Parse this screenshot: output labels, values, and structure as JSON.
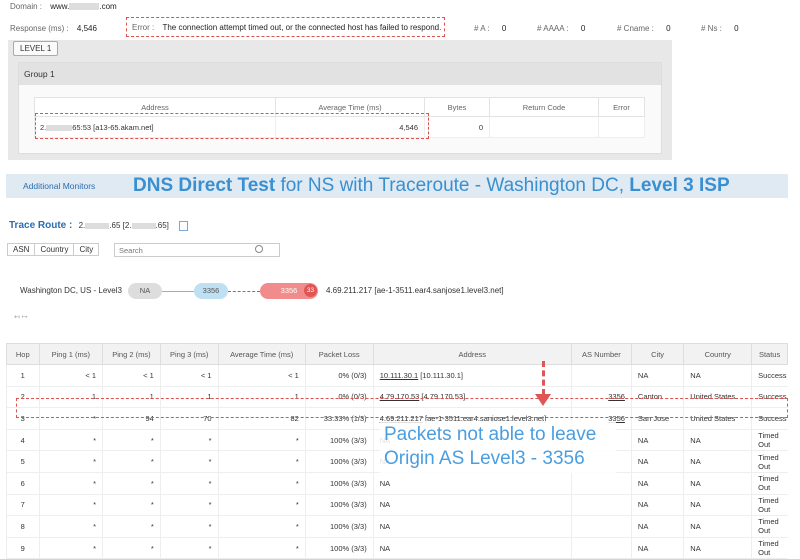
{
  "top": {
    "domain_label": "Domain :",
    "domain_value": "www.",
    "domain_suffix": ".com",
    "response_label": "Response (ms) :",
    "response_value": "4,546",
    "error_label": "Error :",
    "error_text": "The connection attempt timed out, or the connected host has failed to respond.",
    "a_label": "# A :",
    "a_value": "0",
    "aaaa_label": "# AAAA :",
    "aaaa_value": "0",
    "cname_label": "# Cname :",
    "cname_value": "0",
    "ns_label": "# Ns :",
    "ns_value": "0"
  },
  "level_button": "LEVEL 1",
  "group": {
    "title": "Group 1",
    "columns": [
      "Address",
      "Average Time (ms)",
      "Bytes",
      "Return Code",
      "Error"
    ],
    "row": {
      "address_prefix": "2.",
      "address_suffix": "65:53 [a13-65.akam.net]",
      "avg": "4,546",
      "bytes": "0",
      "return_code": "",
      "error": ""
    }
  },
  "banner": {
    "link": "Additional Monitors",
    "title_bold1": "DNS Direct Test",
    "title_mid": " for NS with Traceroute - Washington DC, ",
    "title_bold2": "Level 3 ISP"
  },
  "traceroute": {
    "label": "Trace Route :",
    "value_prefix": "2.",
    "value_mid": ".65 [2.",
    "value_suffix": ".65]",
    "tabs": [
      "ASN",
      "Country",
      "City"
    ],
    "search_placeholder": "Search",
    "origin": "Washington DC, US - Level3",
    "node1": "NA",
    "node2": "3356",
    "node3": "3356",
    "node3_badge": "33",
    "dest": "4.69.211.217 [ae-1-3511.ear4.sanjose1.level3.net]",
    "collapse": "↤ ↦"
  },
  "hops": {
    "columns": [
      "Hop",
      "Ping 1 (ms)",
      "Ping 2 (ms)",
      "Ping 3 (ms)",
      "Average Time (ms)",
      "Packet Loss",
      "Address",
      "AS Number",
      "City",
      "Country",
      "Status"
    ],
    "rows": [
      {
        "hop": "1",
        "p1": "< 1",
        "p2": "< 1",
        "p3": "< 1",
        "avg": "< 1",
        "loss": "0% (0/3)",
        "addr_link": "10.111.30.1",
        "addr_rest": " [10.111.30.1]",
        "asn": "",
        "city": "NA",
        "country": "NA",
        "status": "Success"
      },
      {
        "hop": "2",
        "p1": "1",
        "p2": "1",
        "p3": "1",
        "avg": "1",
        "loss": "0% (0/3)",
        "addr_link": "4.79.170.53",
        "addr_rest": " [4.79.170.53]",
        "asn": "3356",
        "city": "Canton",
        "country": "United States",
        "status": "Success"
      },
      {
        "hop": "3",
        "p1": "*",
        "p2": "94",
        "p3": "70",
        "avg": "82",
        "loss": "33.33% (1/3)",
        "addr_link": "4.69.211.217",
        "addr_rest": " [ae-1-3511.ear4.sanjose1.level3.net]",
        "asn": "3356",
        "city": "San Jose",
        "country": "United States",
        "status": "Success"
      },
      {
        "hop": "4",
        "p1": "*",
        "p2": "*",
        "p3": "*",
        "avg": "*",
        "loss": "100% (3/3)",
        "addr_link": "",
        "addr_rest": "NA",
        "asn": "",
        "city": "NA",
        "country": "NA",
        "status": "Timed Out"
      },
      {
        "hop": "5",
        "p1": "*",
        "p2": "*",
        "p3": "*",
        "avg": "*",
        "loss": "100% (3/3)",
        "addr_link": "",
        "addr_rest": "NA",
        "asn": "",
        "city": "NA",
        "country": "NA",
        "status": "Timed Out"
      },
      {
        "hop": "6",
        "p1": "*",
        "p2": "*",
        "p3": "*",
        "avg": "*",
        "loss": "100% (3/3)",
        "addr_link": "",
        "addr_rest": "NA",
        "asn": "",
        "city": "NA",
        "country": "NA",
        "status": "Timed Out"
      },
      {
        "hop": "7",
        "p1": "*",
        "p2": "*",
        "p3": "*",
        "avg": "*",
        "loss": "100% (3/3)",
        "addr_link": "",
        "addr_rest": "NA",
        "asn": "",
        "city": "NA",
        "country": "NA",
        "status": "Timed Out"
      },
      {
        "hop": "8",
        "p1": "*",
        "p2": "*",
        "p3": "*",
        "avg": "*",
        "loss": "100% (3/3)",
        "addr_link": "",
        "addr_rest": "NA",
        "asn": "",
        "city": "NA",
        "country": "NA",
        "status": "Timed Out"
      },
      {
        "hop": "9",
        "p1": "*",
        "p2": "*",
        "p3": "*",
        "avg": "*",
        "loss": "100% (3/3)",
        "addr_link": "",
        "addr_rest": "NA",
        "asn": "",
        "city": "NA",
        "country": "NA",
        "status": "Timed Out"
      }
    ]
  },
  "annotation": {
    "line1": "Packets not able to leave",
    "line2": "Origin AS Level3 - 3356"
  },
  "colors": {
    "accent_blue": "#3a8fd0",
    "highlight_red": "#d9534f",
    "node_blue": "#bfe0f2",
    "node_red": "#f28b8b"
  }
}
